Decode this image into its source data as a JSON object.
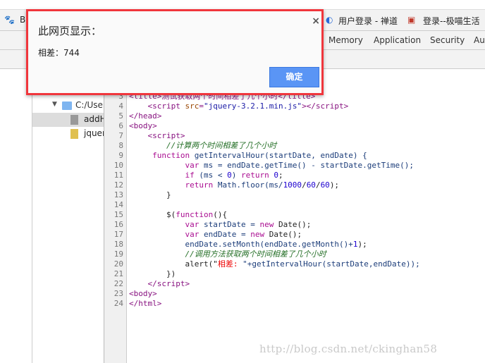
{
  "bookmarks": [
    {
      "label": "B",
      "icon": "baidu-paw-icon"
    },
    {
      "label": "用户登录 - 禅道",
      "icon": "globe-icon"
    },
    {
      "label": "登录--极喵生活",
      "icon": "red-logo-icon"
    }
  ],
  "devtools_tabs": [
    "Memory",
    "Application",
    "Security",
    "Au"
  ],
  "file_tree": [
    {
      "label": "C:/Users",
      "type": "folder"
    },
    {
      "label": "addH",
      "type": "file",
      "selected": true
    },
    {
      "label": "jquery",
      "type": "js-file"
    }
  ],
  "code": {
    "line_numbers": [
      "3",
      "4",
      "5",
      "6",
      "7",
      "8",
      "9",
      "10",
      "11",
      "12",
      "13",
      "14",
      "15",
      "16",
      "17",
      "18",
      "19",
      "20",
      "21",
      "22",
      "23",
      "24"
    ],
    "line3": "<title>测试获取两个时间相差了几个小时</title>",
    "l4a": "<script ",
    "l4b": "src",
    "l4c": "=",
    "l4d": "\"jquery-3.2.1.min.js\"",
    "l4e": "></script>",
    "l5": "</head>",
    "l6": "<body>",
    "l7": "<script>",
    "l8": "//计算两个时间相差了几个小时",
    "l9a": "function ",
    "l9b": "getIntervalHour(startDate, endDate) {",
    "l10a": "var ",
    "l10b": "ms = endDate.getTime() - startDate.getTime();",
    "l11a": "if ",
    "l11b": "(ms < ",
    "l11c": "0",
    "l11d": ") ",
    "l11e": "return ",
    "l11f": "0",
    "l11g": ";",
    "l12a": "return ",
    "l12b": "Math.floor(ms/",
    "l12c": "1000",
    "l12d": "/",
    "l12e": "60",
    "l12f": "/",
    "l12g": "60",
    "l12h": ");",
    "l13": "}",
    "l15a": "$(",
    "l15b": "function",
    "l15c": "(){",
    "l16a": "var ",
    "l16b": "startDate = ",
    "l16c": "new ",
    "l16d": "Date();",
    "l17a": "var ",
    "l17b": "endDate = ",
    "l17c": "new ",
    "l17d": "Date();",
    "l18a": "endDate.setMonth(endDate.getMonth()+",
    "l18b": "1",
    "l18c": ");",
    "l19": "//调用方法获取两个时间相差了几个小时",
    "l20a": "alert(\"",
    "l20b": "相差: ",
    "l20c": "\"+getIntervalHour(startDate,endDate));",
    "l21": "})",
    "l22": "</script>",
    "l23": "<body>",
    "l24": "</html>"
  },
  "dialog": {
    "title": "此网页显示：",
    "message": "相差：744",
    "ok": "确定",
    "close": "×"
  },
  "watermark": "http://blog.csdn.net/ckinghan58",
  "colors": {
    "dialog_border": "#f0363c",
    "ok_button": "#5a95f5"
  }
}
